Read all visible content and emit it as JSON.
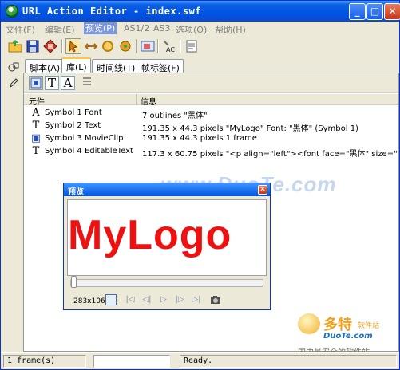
{
  "window": {
    "title": "URL Action Editor - index.swf",
    "buttons": {
      "minimize": "_",
      "maximize": "□",
      "close": "✕"
    }
  },
  "menu": [
    {
      "label": "文件(F)",
      "active": false
    },
    {
      "label": "编辑(E)",
      "active": false
    },
    {
      "label": "预览(P)",
      "active": true
    },
    {
      "label": "AS1/2",
      "active": false
    },
    {
      "label": "AS3",
      "active": false
    },
    {
      "label": "选项(O)",
      "active": false
    },
    {
      "label": "帮助(H)",
      "active": false
    }
  ],
  "toolbar": {
    "icons": [
      "open-folder-icon",
      "save-icon",
      "export-icon",
      "pointer-icon",
      "swap-icon",
      "circle-icon",
      "gear-icon",
      "image-icon",
      "wand-ac-icon",
      "properties-icon"
    ],
    "ac_label": "AC"
  },
  "tabs": [
    {
      "label": "脚本(A)",
      "active": false
    },
    {
      "label": "库(L)",
      "active": true
    },
    {
      "label": "时间线(T)",
      "active": false
    },
    {
      "label": "帧标签(F)",
      "active": false
    }
  ],
  "library": {
    "filter_buttons": [
      "image-filter-icon",
      "text-filter-icon",
      "font-filter-icon",
      "list-icon"
    ],
    "filter_text_glyph": "T",
    "filter_font_glyph": "A",
    "columns": [
      "元件",
      "信息"
    ],
    "rows": [
      {
        "icon": "font-symbol-icon",
        "glyph": "A",
        "name": "Symbol 1 Font",
        "info": "7 outlines \"黑体\""
      },
      {
        "icon": "text-symbol-icon",
        "glyph": "T",
        "name": "Symbol 2 Text",
        "info": "191.35 x 44.3 pixels  \"MyLogo\" Font: \"黑体\" (Symbol 1)"
      },
      {
        "icon": "movieclip-symbol-icon",
        "glyph": "▣",
        "name": "Symbol 3 MovieClip",
        "info": "191.35 x 44.3 pixels  1 frame"
      },
      {
        "icon": "edittext-symbol-icon",
        "glyph": "T",
        "name": "Symbol 4 EditableText",
        "info": "117.3 x 60.75 pixels  \"<p align=\"left\"><font face=\"黑体\" size=\"50\" c..."
      }
    ]
  },
  "watermark": "www.DuoTe.com",
  "preview": {
    "title": "预览",
    "logo_text": "MyLogo",
    "size_label": "283x106",
    "slider_position": 0.0,
    "logo_color": "#ee1111"
  },
  "brand": {
    "name": "多特",
    "sub": "软件站",
    "url": "DuoTe.com",
    "footer": "国内最安全的软件站"
  },
  "status": {
    "frames": "1 frame(s)",
    "field": "",
    "message": "Ready."
  }
}
